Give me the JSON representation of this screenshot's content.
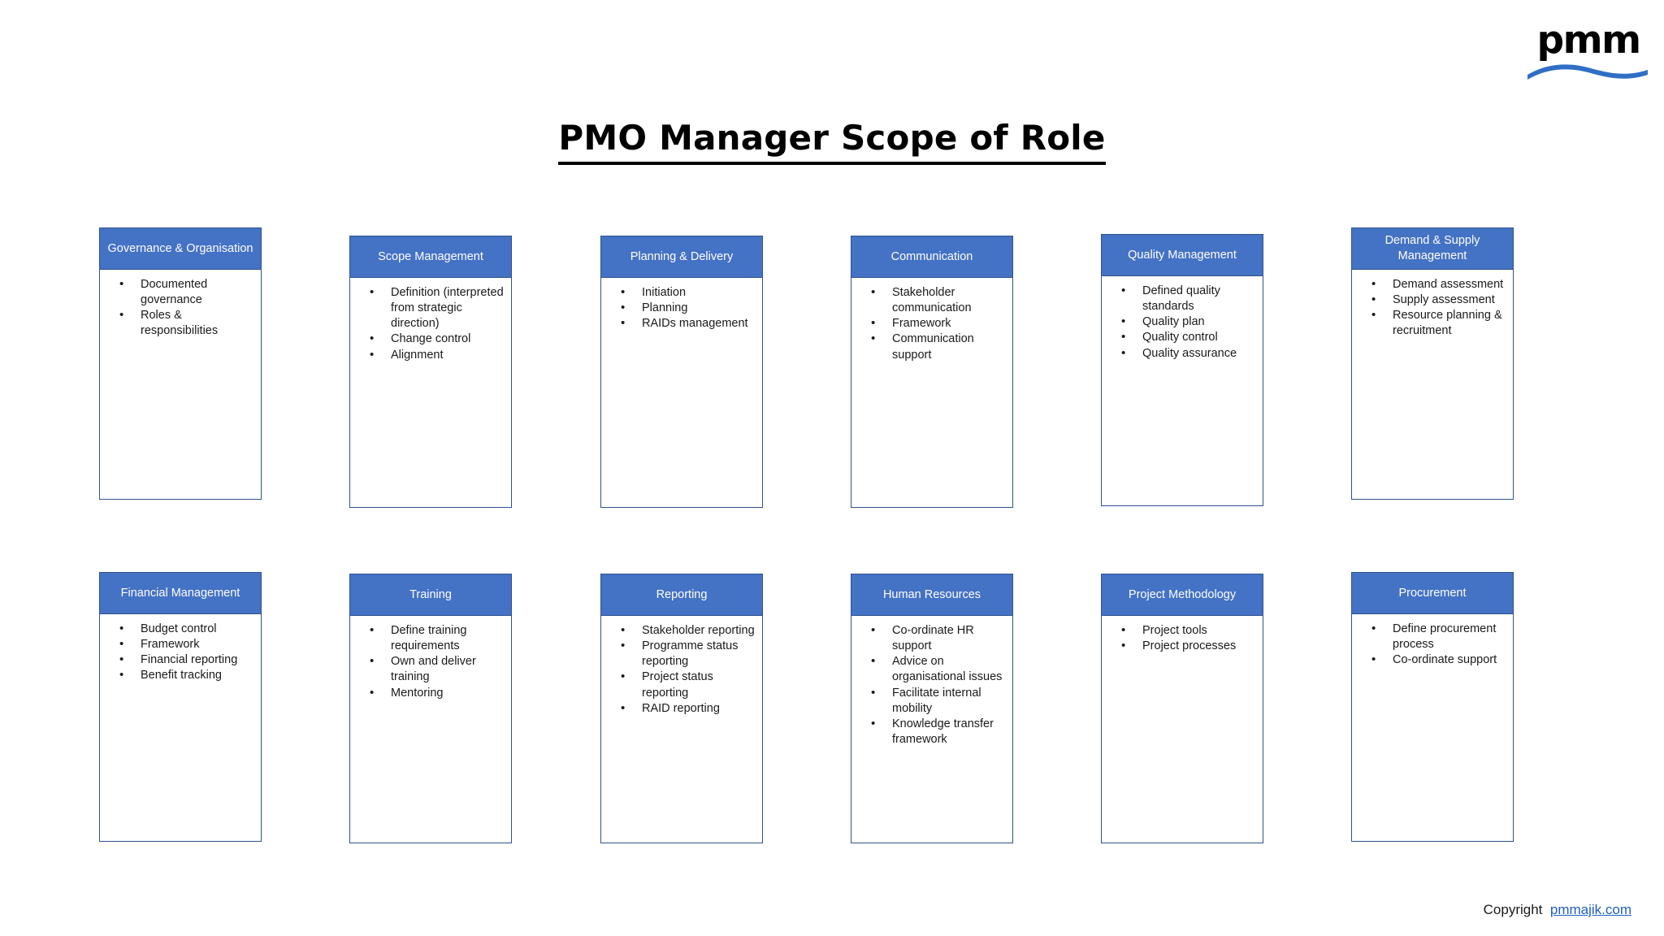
{
  "logo": {
    "wordmark": "pmm",
    "wave_color": "#2f6fc4"
  },
  "title": "PMO Manager Scope of Role",
  "theme": {
    "header_fill": "#4472C4",
    "header_border": "#2f528f",
    "header_text": "#ffffff",
    "body_text": "#1a1a1a",
    "link_color": "#1f5fbf"
  },
  "cards": [
    {
      "title": "Governance & Organisation",
      "bullets": [
        "Documented governance",
        "Roles & responsibilities"
      ]
    },
    {
      "title": "Scope Management",
      "bullets": [
        "Definition (interpreted from strategic direction)",
        "Change control",
        "Alignment"
      ]
    },
    {
      "title": "Planning & Delivery",
      "bullets": [
        "Initiation",
        "Planning",
        "RAIDs management"
      ]
    },
    {
      "title": "Communication",
      "bullets": [
        "Stakeholder communication",
        "Framework",
        "Communication support"
      ]
    },
    {
      "title": "Quality Management",
      "bullets": [
        "Defined quality standards",
        "Quality plan",
        "Quality control",
        "Quality assurance"
      ]
    },
    {
      "title": "Demand & Supply Management",
      "bullets": [
        "Demand assessment",
        "Supply assessment",
        "Resource planning & recruitment"
      ]
    },
    {
      "title": "Financial Management",
      "bullets": [
        "Budget control",
        "Framework",
        "Financial reporting",
        "Benefit tracking"
      ]
    },
    {
      "title": "Training",
      "bullets": [
        "Define training requirements",
        "Own and deliver training",
        "Mentoring"
      ]
    },
    {
      "title": "Reporting",
      "bullets": [
        "Stakeholder reporting",
        "Programme status reporting",
        "Project status reporting",
        "RAID reporting"
      ]
    },
    {
      "title": "Human Resources",
      "bullets": [
        "Co-ordinate HR support",
        "Advice on organisational issues",
        "Facilitate internal mobility",
        "Knowledge transfer framework"
      ]
    },
    {
      "title": "Project Methodology",
      "bullets": [
        "Project tools",
        "Project processes"
      ]
    },
    {
      "title": "Procurement",
      "bullets": [
        "Define procurement process",
        "Co-ordinate support"
      ]
    }
  ],
  "footer": {
    "copyright_label": "Copyright",
    "link_text": "pmmajik.com"
  }
}
